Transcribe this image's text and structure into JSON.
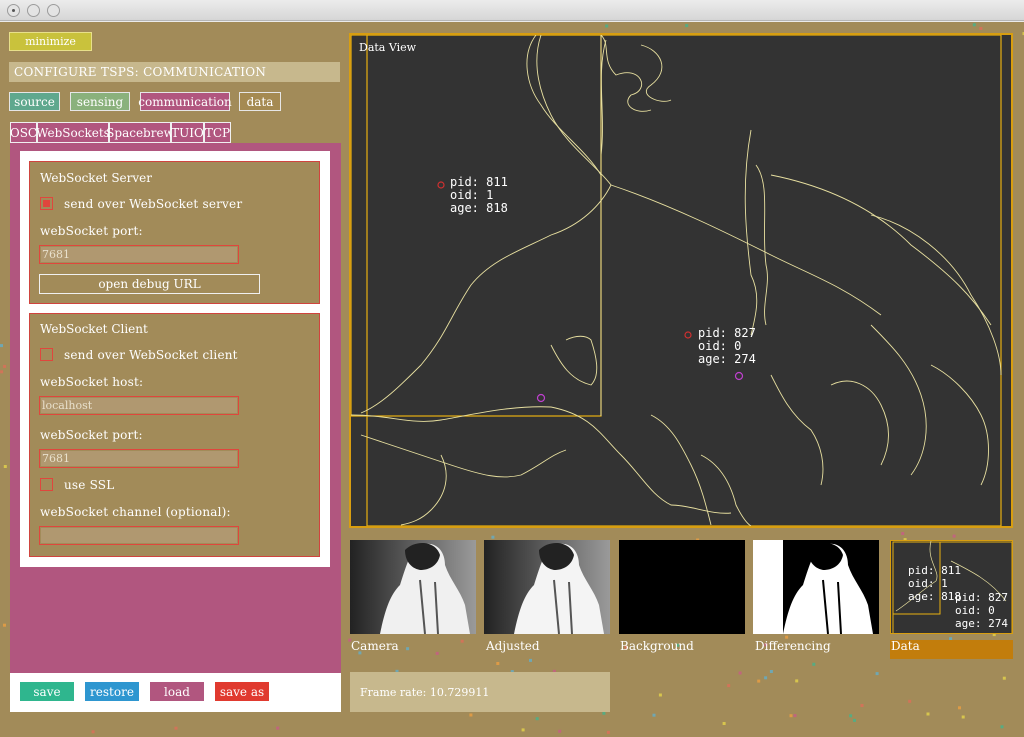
{
  "window": {
    "buttons": [
      "close",
      "minimize",
      "zoom"
    ]
  },
  "sidebar": {
    "minimize_label": "minimize",
    "config_title": "CONFIGURE TSPS: COMMUNICATION",
    "nav_tabs": [
      {
        "label": "source",
        "color": "#5fa88e"
      },
      {
        "label": "sensing",
        "color": "#8ab17c"
      },
      {
        "label": "communication",
        "color": "#b1567f"
      },
      {
        "label": "data",
        "color": "#a58a52"
      }
    ],
    "sub_tabs": [
      "OSC",
      "WebSockets",
      "Spacebrew",
      "TUIO",
      "TCP"
    ],
    "server": {
      "title": "WebSocket Server",
      "send_label": "send over WebSocket server",
      "send_checked": true,
      "port_label": "webSocket port:",
      "port_value": "7681",
      "debug_label": "open debug URL"
    },
    "client": {
      "title": "WebSocket Client",
      "send_label": "send over WebSocket client",
      "send_checked": false,
      "host_label": "webSocket host:",
      "host_value": "localhost",
      "port_label": "webSocket port:",
      "port_value": "7681",
      "ssl_label": "use SSL",
      "ssl_checked": false,
      "channel_label": "webSocket channel (optional):",
      "channel_value": ""
    },
    "actions": [
      {
        "label": "save",
        "color": "#2fb68e"
      },
      {
        "label": "restore",
        "color": "#2e96d0"
      },
      {
        "label": "load",
        "color": "#b1567f"
      },
      {
        "label": "save as",
        "color": "#e03a2f"
      }
    ]
  },
  "dataview": {
    "title": "Data View",
    "people": [
      {
        "pid_line": "pid: 811",
        "oid_line": "oid: 1",
        "age_line": "age: 818"
      },
      {
        "pid_line": "pid: 827",
        "oid_line": "oid: 0",
        "age_line": "age: 274"
      }
    ]
  },
  "thumbnails": [
    {
      "label": "Camera"
    },
    {
      "label": "Adjusted"
    },
    {
      "label": "Background"
    },
    {
      "label": "Differencing"
    },
    {
      "label": "Data"
    }
  ],
  "mini_people": [
    {
      "pid_line": "pid: 811",
      "oid_line": "oid: 1",
      "age_line": "age: 818"
    },
    {
      "pid_line": "pid: 827",
      "oid_line": "oid: 0",
      "age_line": "age: 274"
    }
  ],
  "status": {
    "frame_rate_text": "Frame rate: 10.729911"
  },
  "colors": {
    "accent_box": "#d89e10",
    "contour": "#e8e0a0",
    "data_view_bg": "#333333",
    "panel_pink": "#b1567f",
    "panel_tan": "#a28b59"
  }
}
